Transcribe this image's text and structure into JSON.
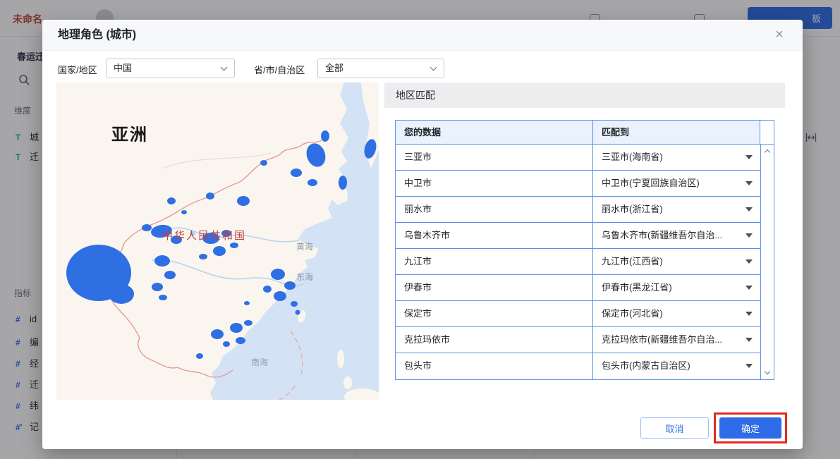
{
  "app": {
    "doc_title": "未命名...",
    "primary_button_label": "板",
    "sidebar": {
      "dataset_title": "春运迁",
      "dimensions_label": "维度",
      "measures_label": "指标",
      "dimension_fields": [
        {
          "icon": "T",
          "label": "城"
        },
        {
          "icon": "T",
          "label": "迁"
        }
      ],
      "measure_fields": [
        {
          "icon": "#",
          "label": "id"
        },
        {
          "icon": "#",
          "label": "编"
        },
        {
          "icon": "#",
          "label": "经"
        },
        {
          "icon": "#",
          "label": "迁"
        },
        {
          "icon": "#",
          "label": "纬"
        },
        {
          "icon": "#'",
          "label": "记"
        }
      ]
    }
  },
  "dialog": {
    "title": "地理角色 (城市)",
    "close_label": "×",
    "filters": {
      "country_label": "国家/地区",
      "country_value": "中国",
      "province_label": "省/市/自治区",
      "province_value": "全部"
    },
    "map": {
      "continent_label": "亚洲",
      "country_label": "中华人民共和国",
      "sea_labels": [
        "黄海",
        "东海",
        "南海"
      ]
    },
    "match_panel": {
      "title": "地区匹配",
      "columns": [
        "您的数据",
        "匹配到"
      ],
      "rows": [
        {
          "source": "三亚市",
          "matched": "三亚市(海南省)"
        },
        {
          "source": "中卫市",
          "matched": "中卫市(宁夏回族自治区)"
        },
        {
          "source": "丽水市",
          "matched": "丽水市(浙江省)"
        },
        {
          "source": "乌鲁木齐市",
          "matched": "乌鲁木齐市(新疆维吾尔自治..."
        },
        {
          "source": "九江市",
          "matched": "九江市(江西省)"
        },
        {
          "source": "伊春市",
          "matched": "伊春市(黑龙江省)"
        },
        {
          "source": "保定市",
          "matched": "保定市(河北省)"
        },
        {
          "source": "克拉玛依市",
          "matched": "克拉玛依市(新疆维吾尔自治..."
        },
        {
          "source": "包头市",
          "matched": "包头市(内蒙古自治区)"
        }
      ]
    },
    "footer": {
      "cancel_label": "取消",
      "ok_label": "确定"
    }
  },
  "colors": {
    "accent_blue": "#2e6be6",
    "table_border": "#5f8fe8",
    "map_highlight": "#2f6fe4",
    "annotation_red": "#e12b20"
  }
}
